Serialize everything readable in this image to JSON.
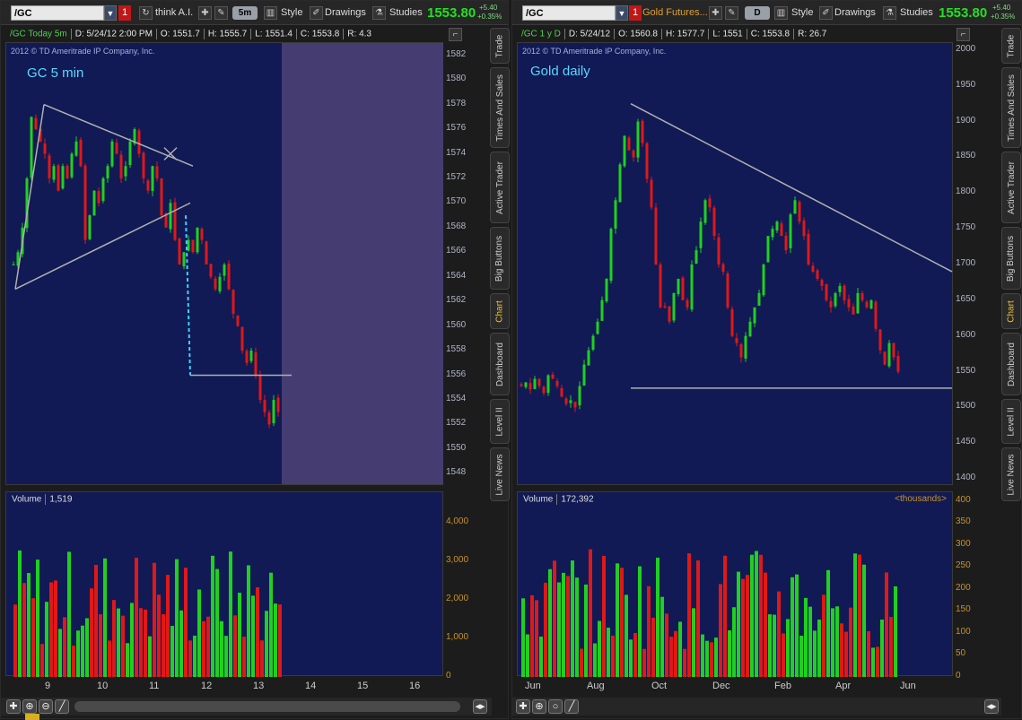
{
  "left": {
    "toolbar": {
      "symbol": "/GC",
      "link_tag": "1",
      "tool_label": "think A.I.",
      "aggregation": "5m",
      "style_label": "Style",
      "drawings_label": "Drawings",
      "studies_label": "Studies",
      "last_price": "1553.80",
      "change": "+5.40",
      "change_pct": "+0.35%"
    },
    "info": {
      "title": "/GC Today 5m",
      "date": "D: 5/24/12 2:00 PM",
      "open": "O: 1551.7",
      "high": "H: 1555.7",
      "low": "L: 1551.4",
      "close": "C: 1553.8",
      "range": "R: 4.3"
    },
    "copyright": "2012 © TD Ameritrade IP Company, Inc.",
    "chart_title": "GC 5 min",
    "volume_label": "Volume",
    "volume_value": "1,519"
  },
  "right": {
    "toolbar": {
      "symbol": "/GC",
      "link_tag": "1",
      "tool_label": "Gold Futures...",
      "aggregation": "D",
      "style_label": "Style",
      "drawings_label": "Drawings",
      "studies_label": "Studies",
      "last_price": "1553.80",
      "change": "+5.40",
      "change_pct": "+0.35%"
    },
    "info": {
      "title": "/GC 1 y D",
      "date": "D: 5/24/12",
      "open": "O: 1560.8",
      "high": "H: 1577.7",
      "low": "L: 1551",
      "close": "C: 1553.8",
      "range": "R: 26.7"
    },
    "copyright": "2012 © TD Ameritrade IP Company, Inc.",
    "chart_title": "Gold daily",
    "volume_label": "Volume",
    "volume_value": "172,392",
    "volume_units": "<thousands>"
  },
  "side_tabs": [
    "Trade",
    "Times And Sales",
    "Active Trader",
    "Big Buttons",
    "Chart",
    "Dashboard",
    "Level II",
    "Live News"
  ],
  "active_tab": "Chart",
  "chart_data": [
    {
      "type": "candlestick",
      "title": "GC 5 min",
      "x_ticks": [
        "9",
        "10",
        "11",
        "12",
        "13",
        "14",
        "15",
        "16"
      ],
      "y_ticks": [
        "1582",
        "1580",
        "1578",
        "1576",
        "1574",
        "1572",
        "1570",
        "1568",
        "1566",
        "1564",
        "1562",
        "1560",
        "1558",
        "1556",
        "1554",
        "1552",
        "1550",
        "1548"
      ],
      "ylim": [
        1547,
        1583
      ],
      "volume_ticks": [
        "4,000",
        "3,000",
        "2,000",
        "1,000",
        "0"
      ],
      "volume_ylim": [
        0,
        4800
      ],
      "closes": [
        1565,
        1566,
        1568,
        1572,
        1577,
        1576,
        1575,
        1574,
        1572,
        1573,
        1571,
        1573,
        1572,
        1574,
        1575,
        1573,
        1567,
        1569,
        1571,
        1570,
        1572,
        1573,
        1575,
        1574,
        1572,
        1573,
        1575,
        1576,
        1574,
        1572,
        1571,
        1573,
        1572,
        1569,
        1568,
        1570,
        1567,
        1565,
        1566,
        1567,
        1566,
        1568,
        1567,
        1565,
        1564,
        1563,
        1564,
        1565,
        1563,
        1561,
        1560,
        1558,
        1557,
        1558,
        1556,
        1554,
        1553,
        1552,
        1554,
        1553
      ]
    },
    {
      "type": "candlestick",
      "title": "Gold daily",
      "x_ticks": [
        "Jun",
        "Aug",
        "Oct",
        "Dec",
        "Feb",
        "Apr",
        "Jun"
      ],
      "y_ticks": [
        "2000",
        "1950",
        "1900",
        "1850",
        "1800",
        "1750",
        "1700",
        "1650",
        "1600",
        "1550",
        "1500",
        "1450",
        "1400"
      ],
      "ylim": [
        1390,
        2010
      ],
      "volume_ticks": [
        "400",
        "350",
        "300",
        "250",
        "200",
        "150",
        "100",
        "50",
        "0"
      ],
      "volume_ylim": [
        0,
        420
      ],
      "closes": [
        1530,
        1535,
        1525,
        1540,
        1530,
        1520,
        1545,
        1540,
        1530,
        1515,
        1505,
        1510,
        1500,
        1530,
        1560,
        1580,
        1600,
        1620,
        1650,
        1680,
        1750,
        1790,
        1840,
        1880,
        1860,
        1850,
        1900,
        1870,
        1820,
        1780,
        1700,
        1640,
        1640,
        1620,
        1660,
        1680,
        1650,
        1640,
        1700,
        1720,
        1760,
        1790,
        1780,
        1740,
        1700,
        1690,
        1640,
        1600,
        1590,
        1570,
        1600,
        1620,
        1640,
        1660,
        1700,
        1740,
        1750,
        1760,
        1740,
        1720,
        1770,
        1790,
        1760,
        1740,
        1700,
        1690,
        1680,
        1670,
        1650,
        1640,
        1660,
        1670,
        1650,
        1640,
        1630,
        1660,
        1650,
        1640,
        1650,
        1610,
        1580,
        1560,
        1590,
        1570,
        1550
      ]
    }
  ]
}
